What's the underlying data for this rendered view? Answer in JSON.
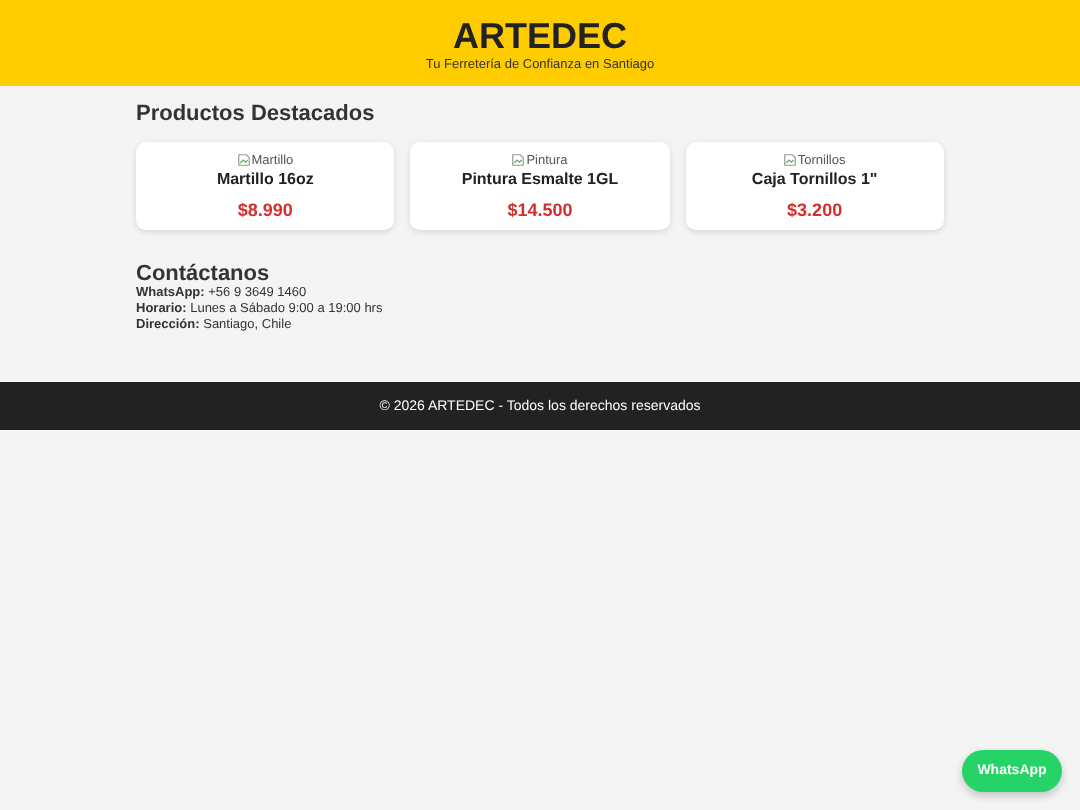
{
  "header": {
    "title": "ARTEDEC",
    "tagline": "Tu Ferretería de Confianza en Santiago"
  },
  "products": {
    "heading": "Productos Destacados",
    "items": [
      {
        "image_alt": "Martillo",
        "name": "Martillo 16oz",
        "price": "$8.990"
      },
      {
        "image_alt": "Pintura",
        "name": "Pintura Esmalte 1GL",
        "price": "$14.500"
      },
      {
        "image_alt": "Tornillos",
        "name": "Caja Tornillos 1\"",
        "price": "$3.200"
      }
    ]
  },
  "contact": {
    "heading": "Contáctanos",
    "lines": [
      {
        "label": "WhatsApp:",
        "value": "+56 9 3649 1460"
      },
      {
        "label": "Horario:",
        "value": "Lunes a Sábado 9:00 a 19:00 hrs"
      },
      {
        "label": "Dirección:",
        "value": "Santiago, Chile"
      }
    ]
  },
  "footer": "© 2026 ARTEDEC - Todos los derechos reservados",
  "whatsapp_button": "WhatsApp"
}
